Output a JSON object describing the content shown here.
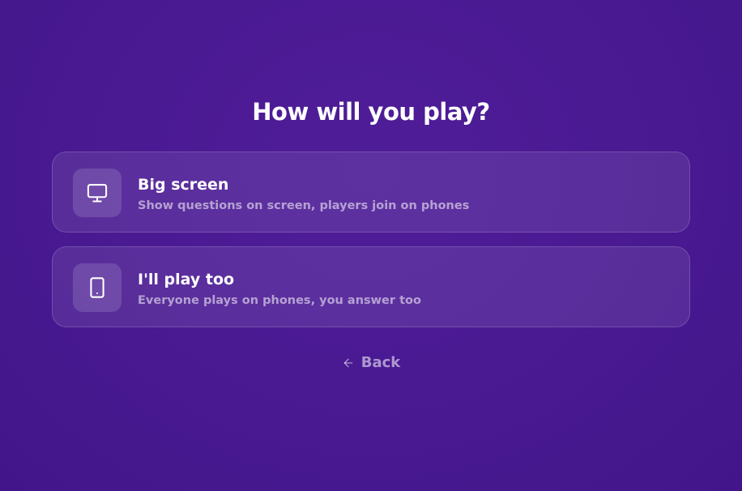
{
  "title": "How will you play?",
  "options": [
    {
      "icon": "monitor-icon",
      "title": "Big screen",
      "description": "Show questions on screen, players join on phones"
    },
    {
      "icon": "tablet-icon",
      "title": "I'll play too",
      "description": "Everyone plays on phones, you answer too"
    }
  ],
  "back": {
    "icon": "arrow-left-icon",
    "label": "Back"
  },
  "colors": {
    "background": "#4a1a93",
    "text": "#ffffff"
  }
}
